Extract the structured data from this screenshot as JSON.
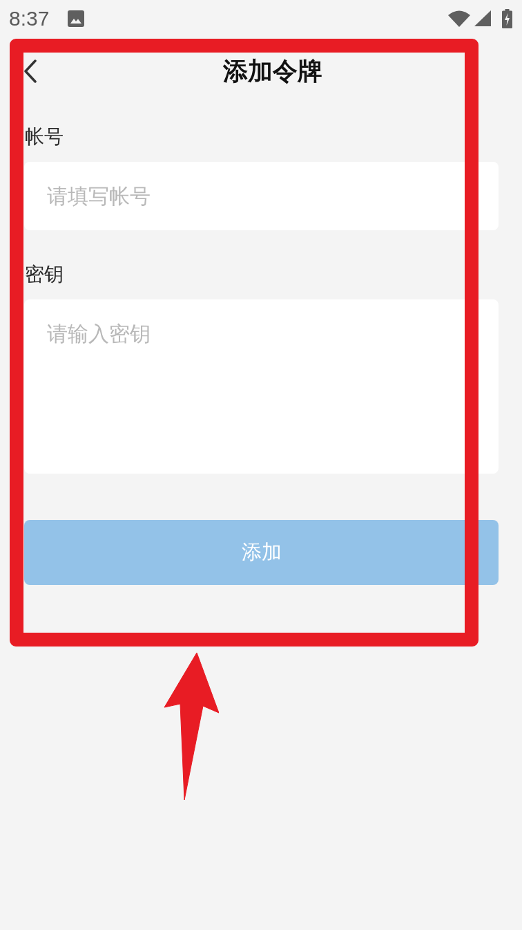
{
  "status_bar": {
    "time": "8:37"
  },
  "header": {
    "title": "添加令牌"
  },
  "fields": [
    {
      "kind": "input",
      "label": "帐号",
      "placeholder": "请填写帐号"
    },
    {
      "kind": "textarea",
      "label": "密钥",
      "placeholder": "请输入密钥"
    }
  ],
  "submit_button": {
    "label": "添加",
    "disabled": true
  }
}
